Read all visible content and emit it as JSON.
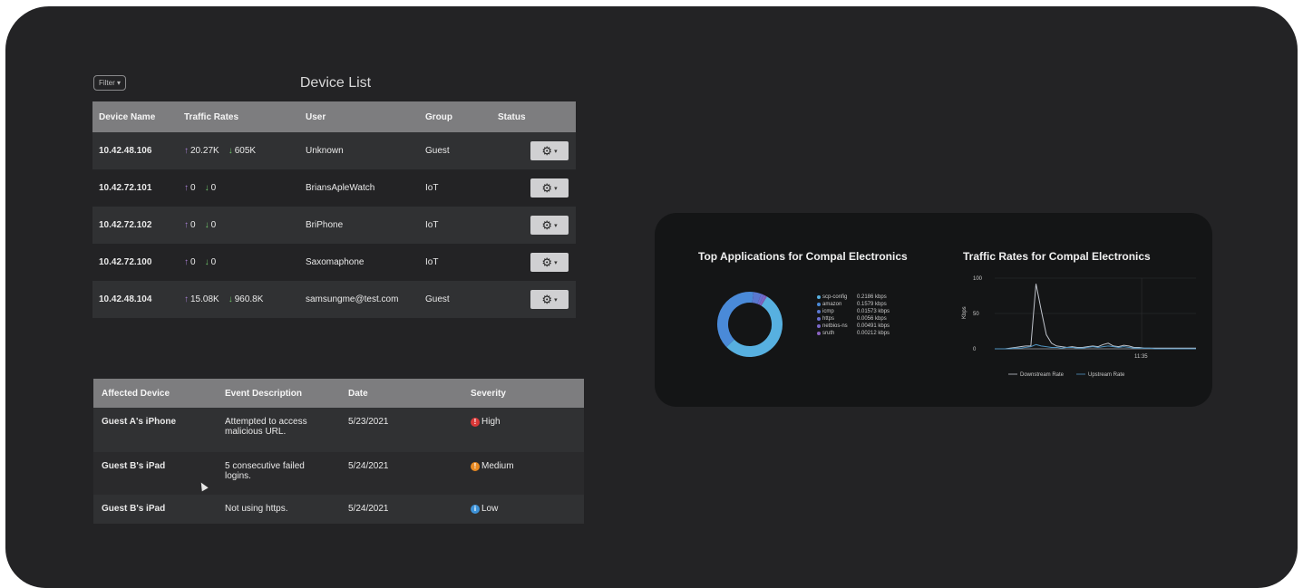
{
  "device_list": {
    "filter_label": "Filter ▾",
    "title": "Device List",
    "columns": [
      "Device Name",
      "Traffic Rates",
      "User",
      "Group",
      "Status"
    ],
    "rows": [
      {
        "device": "10.42.48.106",
        "up": "20.27K",
        "down": "605K",
        "user": "Unknown",
        "group": "Guest"
      },
      {
        "device": "10.42.72.101",
        "up": "0",
        "down": "0",
        "user": "BriansApleWatch",
        "group": "IoT"
      },
      {
        "device": "10.42.72.102",
        "up": "0",
        "down": "0",
        "user": "BriPhone",
        "group": "IoT"
      },
      {
        "device": "10.42.72.100",
        "up": "0",
        "down": "0",
        "user": "Saxomaphone",
        "group": "IoT"
      },
      {
        "device": "10.42.48.104",
        "up": "15.08K",
        "down": "960.8K",
        "user": "samsungme@test.com",
        "group": "Guest"
      }
    ]
  },
  "events": {
    "columns": [
      "Affected Device",
      "Event Description",
      "Date",
      "Severity"
    ],
    "rows": [
      {
        "device": "Guest A's iPhone",
        "desc": "Attempted to access malicious URL.",
        "date": "5/23/2021",
        "severity": "High",
        "sev_color": "#d93838"
      },
      {
        "device": "Guest B's iPad",
        "desc": "5 consecutive failed logins.",
        "date": "5/24/2021",
        "severity": "Medium",
        "sev_color": "#e98a22"
      },
      {
        "device": "Guest B's iPad",
        "desc": "Not using https.",
        "date": "5/24/2021",
        "severity": "Low",
        "sev_color": "#3d92d8"
      }
    ]
  },
  "apps_panel": {
    "title": "Top Applications for Compal Electronics",
    "legend": [
      {
        "name": "scp-config",
        "value": "0.2186 kbps",
        "color": "#57b0e0"
      },
      {
        "name": "amazon",
        "value": "0.1579 kbps",
        "color": "#4a8ad8"
      },
      {
        "name": "icmp",
        "value": "0.01573 kbps",
        "color": "#5a78d0"
      },
      {
        "name": "https",
        "value": "0.0056 kbps",
        "color": "#6b6fd0"
      },
      {
        "name": "netbios-ns",
        "value": "0.00491 kbps",
        "color": "#7b68c8"
      },
      {
        "name": "sruth",
        "value": "0.00212 kbps",
        "color": "#8a62c0"
      }
    ],
    "donut_values": [
      0.2186,
      0.1579,
      0.01573,
      0.0056,
      0.00491,
      0.00212
    ]
  },
  "chart_data": {
    "type": "line",
    "title": "Traffic Rates for Compal Electronics",
    "ylabel": "Kbps",
    "ylim": [
      0,
      100
    ],
    "yticks": [
      0,
      50,
      100
    ],
    "xtick_labels": [
      "11:35"
    ],
    "series": [
      {
        "name": "Downstream Rate",
        "color": "#c0c4cc",
        "values": [
          0,
          0,
          0,
          1,
          2,
          3,
          4,
          4,
          92,
          55,
          20,
          8,
          4,
          3,
          2,
          3,
          2,
          2,
          3,
          4,
          3,
          6,
          8,
          4,
          3,
          5,
          4,
          2,
          2,
          1,
          1,
          1,
          1,
          1,
          1,
          1,
          1,
          1,
          1,
          1
        ]
      },
      {
        "name": "Upstream Rate",
        "color": "#4f93c0",
        "values": [
          0,
          0,
          0,
          0,
          1,
          1,
          2,
          3,
          6,
          4,
          3,
          2,
          2,
          1,
          2,
          2,
          1,
          1,
          2,
          3,
          2,
          3,
          4,
          3,
          2,
          3,
          2,
          1,
          1,
          1,
          1,
          0,
          0,
          0,
          0,
          0,
          0,
          0,
          0,
          0
        ]
      }
    ]
  }
}
